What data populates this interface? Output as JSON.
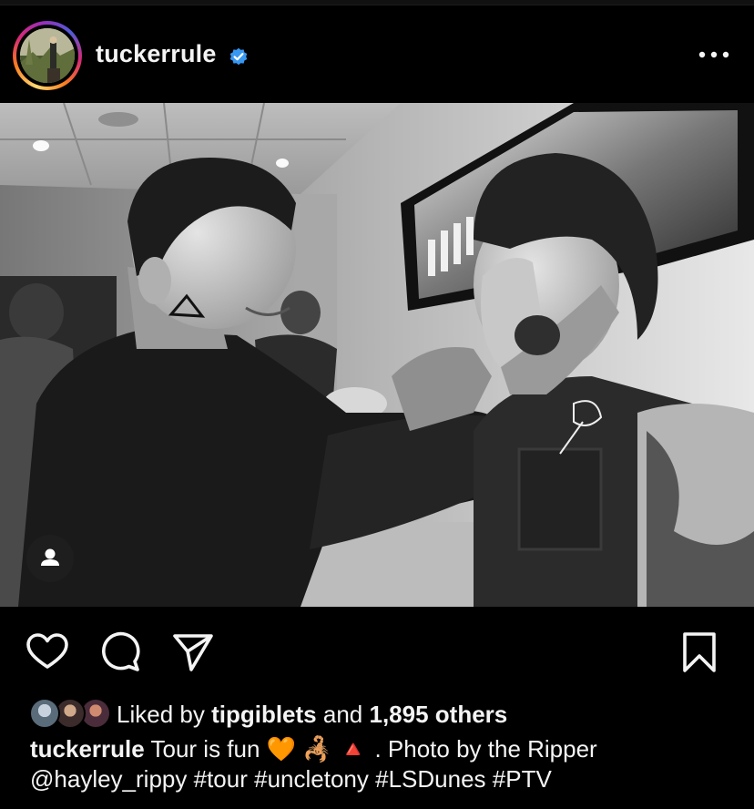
{
  "post": {
    "username": "tuckerrule",
    "verified_icon": "verified-badge-icon",
    "more_icon": "more-options-icon",
    "photo_alt_icon": "person-tag-icon"
  },
  "actions": {
    "like_icon": "heart-icon",
    "comment_icon": "comment-icon",
    "share_icon": "send-icon",
    "save_icon": "bookmark-icon"
  },
  "likes": {
    "prefix": "Liked by",
    "liker": "tipgiblets",
    "conjunction": "and",
    "count": "1,895 others"
  },
  "caption": {
    "username": "tuckerrule",
    "text": "Tour is fun 🧡 🦂 🔺 . Photo by the Ripper",
    "mention": "@hayley_rippy",
    "hashtags": [
      "#tour",
      "#uncletony",
      "#LSDunes",
      "#PTV"
    ]
  },
  "colors": {
    "background": "#000000",
    "verified_blue": "#3897f0",
    "text": "#f4f4f4"
  }
}
